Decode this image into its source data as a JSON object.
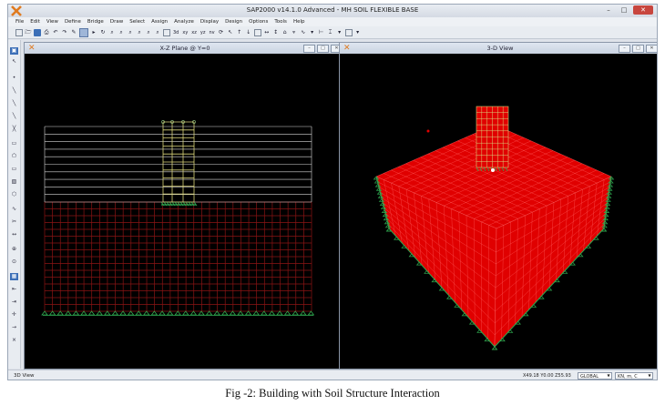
{
  "window": {
    "title": "SAP2000 v14.1.0 Advanced  - MH SOIL FLEXIBLE BASE",
    "controls": [
      "–",
      "□",
      "✕"
    ]
  },
  "menu": [
    "File",
    "Edit",
    "View",
    "Define",
    "Bridge",
    "Draw",
    "Select",
    "Assign",
    "Analyze",
    "Display",
    "Design",
    "Options",
    "Tools",
    "Help"
  ],
  "toolbar": {
    "labels": {
      "view3d": "3d",
      "xy": "xy",
      "xz": "xz",
      "yz": "yz",
      "nv": "nv"
    }
  },
  "panels": {
    "left": {
      "title": "X-Z Plane @ Y=0"
    },
    "right": {
      "title": "3-D View"
    }
  },
  "status": {
    "left": "3D View",
    "coords": "X49.18  Y0.00  Z55.93",
    "csys": "GLOBAL",
    "units": "KN, m, C"
  },
  "caption": "Fig -2: Building with Soil Structure Interaction",
  "colors": {
    "soil_grid": "#8b1414",
    "building_frame": "#d8d27a",
    "restraint_supports": "#2fa84f",
    "soil_solid": "#e00000",
    "grid_line": "#d8d8d8"
  }
}
